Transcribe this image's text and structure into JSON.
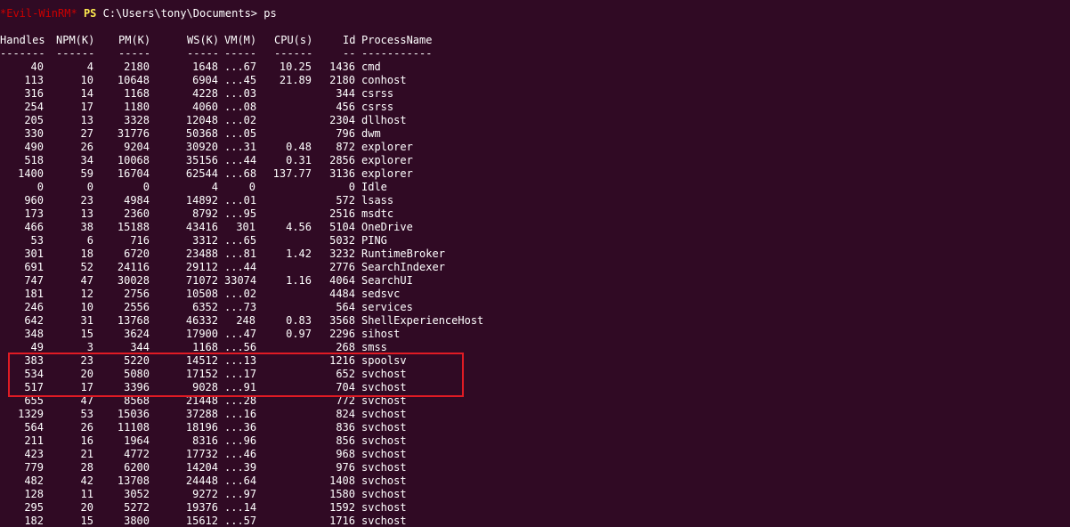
{
  "prompt": {
    "evil": "*Evil-WinRM*",
    "ps": "PS",
    "path": "C:\\Users\\tony\\Documents>",
    "command": "ps"
  },
  "headers": [
    "Handles",
    "NPM(K)",
    "PM(K)",
    "WS(K)",
    "VM(M)",
    "CPU(s)",
    "Id",
    "ProcessName"
  ],
  "separators": [
    "-------",
    "------",
    "-----",
    "-----",
    "-----",
    "------",
    "--",
    "-----------"
  ],
  "rows": [
    [
      "40",
      "4",
      "2180",
      "1648",
      "...67",
      "10.25",
      "1436",
      "cmd"
    ],
    [
      "113",
      "10",
      "10648",
      "6904",
      "...45",
      "21.89",
      "2180",
      "conhost"
    ],
    [
      "316",
      "14",
      "1168",
      "4228",
      "...03",
      "",
      "344",
      "csrss"
    ],
    [
      "254",
      "17",
      "1180",
      "4060",
      "...08",
      "",
      "456",
      "csrss"
    ],
    [
      "205",
      "13",
      "3328",
      "12048",
      "...02",
      "",
      "2304",
      "dllhost"
    ],
    [
      "330",
      "27",
      "31776",
      "50368",
      "...05",
      "",
      "796",
      "dwm"
    ],
    [
      "490",
      "26",
      "9204",
      "30920",
      "...31",
      "0.48",
      "872",
      "explorer"
    ],
    [
      "518",
      "34",
      "10068",
      "35156",
      "...44",
      "0.31",
      "2856",
      "explorer"
    ],
    [
      "1400",
      "59",
      "16704",
      "62544",
      "...68",
      "137.77",
      "3136",
      "explorer"
    ],
    [
      "0",
      "0",
      "0",
      "4",
      "0",
      "",
      "0",
      "Idle"
    ],
    [
      "960",
      "23",
      "4984",
      "14892",
      "...01",
      "",
      "572",
      "lsass"
    ],
    [
      "173",
      "13",
      "2360",
      "8792",
      "...95",
      "",
      "2516",
      "msdtc"
    ],
    [
      "466",
      "38",
      "15188",
      "43416",
      "301",
      "4.56",
      "5104",
      "OneDrive"
    ],
    [
      "53",
      "6",
      "716",
      "3312",
      "...65",
      "",
      "5032",
      "PING"
    ],
    [
      "301",
      "18",
      "6720",
      "23488",
      "...81",
      "1.42",
      "3232",
      "RuntimeBroker"
    ],
    [
      "691",
      "52",
      "24116",
      "29112",
      "...44",
      "",
      "2776",
      "SearchIndexer"
    ],
    [
      "747",
      "47",
      "30028",
      "71072",
      "33074",
      "1.16",
      "4064",
      "SearchUI"
    ],
    [
      "181",
      "12",
      "2756",
      "10508",
      "...02",
      "",
      "4484",
      "sedsvc"
    ],
    [
      "246",
      "10",
      "2556",
      "6352",
      "...73",
      "",
      "564",
      "services"
    ],
    [
      "642",
      "31",
      "13768",
      "46332",
      "248",
      "0.83",
      "3568",
      "ShellExperienceHost"
    ],
    [
      "348",
      "15",
      "3624",
      "17900",
      "...47",
      "0.97",
      "2296",
      "sihost"
    ],
    [
      "49",
      "3",
      "344",
      "1168",
      "...56",
      "",
      "268",
      "smss"
    ],
    [
      "383",
      "23",
      "5220",
      "14512",
      "...13",
      "",
      "1216",
      "spoolsv"
    ],
    [
      "534",
      "20",
      "5080",
      "17152",
      "...17",
      "",
      "652",
      "svchost"
    ],
    [
      "517",
      "17",
      "3396",
      "9028",
      "...91",
      "",
      "704",
      "svchost"
    ],
    [
      "655",
      "47",
      "8568",
      "21448",
      "...28",
      "",
      "772",
      "svchost"
    ],
    [
      "1329",
      "53",
      "15036",
      "37288",
      "...16",
      "",
      "824",
      "svchost"
    ],
    [
      "564",
      "26",
      "11108",
      "18196",
      "...36",
      "",
      "836",
      "svchost"
    ],
    [
      "211",
      "16",
      "1964",
      "8316",
      "...96",
      "",
      "856",
      "svchost"
    ],
    [
      "423",
      "21",
      "4772",
      "17732",
      "...46",
      "",
      "968",
      "svchost"
    ],
    [
      "779",
      "28",
      "6200",
      "14204",
      "...39",
      "",
      "976",
      "svchost"
    ],
    [
      "482",
      "42",
      "13708",
      "24448",
      "...64",
      "",
      "1408",
      "svchost"
    ],
    [
      "128",
      "11",
      "3052",
      "9272",
      "...97",
      "",
      "1580",
      "svchost"
    ],
    [
      "295",
      "20",
      "5272",
      "19376",
      "...14",
      "",
      "1592",
      "svchost"
    ],
    [
      "182",
      "15",
      "3800",
      "15612",
      "...57",
      "",
      "1716",
      "svchost"
    ]
  ],
  "colors": {
    "background": "#300a24",
    "evil_prompt": "#cc0000",
    "ps_prompt": "#fce94f",
    "text": "#ffffff",
    "highlight": "#e01b24"
  }
}
